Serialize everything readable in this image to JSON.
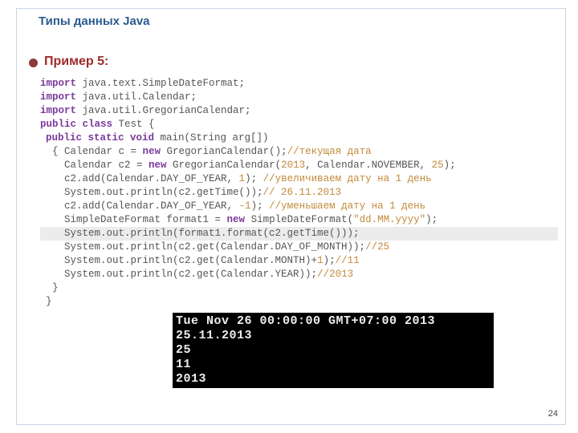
{
  "title": "Типы данных Java",
  "bullet_label": "Пример 5:",
  "page_number": "24",
  "code": {
    "l0": "import",
    "l0b": " java.text.SimpleDateFormat;",
    "l1": "import",
    "l1b": " java.util.Calendar;",
    "l2": "import",
    "l2b": " java.util.GregorianCalendar;",
    "l3a": "public class",
    "l3b": " Test {",
    "l4a": "public static void",
    "l4b": " main(String arg[])",
    "l5a": "{ Calendar c = ",
    "l5b": "new",
    "l5c": " GregorianCalendar();",
    "l5d": "//текущая дата",
    "l6a": "Calendar c2 = ",
    "l6b": "new",
    "l6c": " GregorianCalendar(",
    "l6d": "2013",
    "l6e": ", Calendar.NOVEMBER, ",
    "l6f": "25",
    "l6g": ");",
    "l7a": "c2.add(Calendar.DAY_OF_YEAR, ",
    "l7b": "1",
    "l7c": "); ",
    "l7d": "//увеличиваем дату на 1 день",
    "l8a": "System.out.println(c2.getTime());",
    "l8b": "// 26.11.2013",
    "l9a": "c2.add(Calendar.DAY_OF_YEAR, ",
    "l9b": "-1",
    "l9c": "); ",
    "l9d": "//уменьшаем дату на 1 день",
    "l10a": "SimpleDateFormat format1 = ",
    "l10b": "new",
    "l10c": " SimpleDateFormat(",
    "l10d": "\"dd.MM.yyyy\"",
    "l10e": ");",
    "l11": "System.out.println(format1.format(c2.getTime()));",
    "l12a": "System.out.println(c2.get(Calendar.DAY_OF_MONTH));",
    "l12b": "//25",
    "l13a": "System.out.println(c2.get(Calendar.MONTH)+",
    "l13b": "1",
    "l13c": ");",
    "l13d": "//11",
    "l14a": "System.out.println(c2.get(Calendar.YEAR));",
    "l14b": "//2013",
    "l15": "}",
    "l16": "}"
  },
  "console": {
    "c0": "Tue Nov 26 00:00:00 GMT+07:00 2013",
    "c1": "25.11.2013",
    "c2": "25",
    "c3": "11",
    "c4": "2013"
  }
}
